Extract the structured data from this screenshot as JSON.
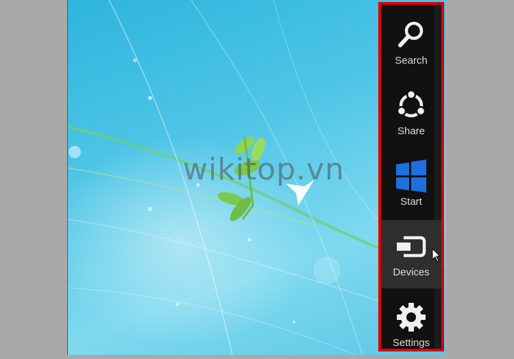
{
  "watermark": "wikitop.vn",
  "charms": [
    {
      "label": "Search",
      "icon": "search-icon"
    },
    {
      "label": "Share",
      "icon": "share-icon"
    },
    {
      "label": "Start",
      "icon": "windows-logo-icon"
    },
    {
      "label": "Devices",
      "icon": "devices-icon"
    },
    {
      "label": "Settings",
      "icon": "gear-icon"
    }
  ],
  "colors": {
    "charm_bar": "#111111",
    "highlight_border": "#e00000",
    "start_logo": "#1e6fe0",
    "hover": "#2f2f2f"
  }
}
